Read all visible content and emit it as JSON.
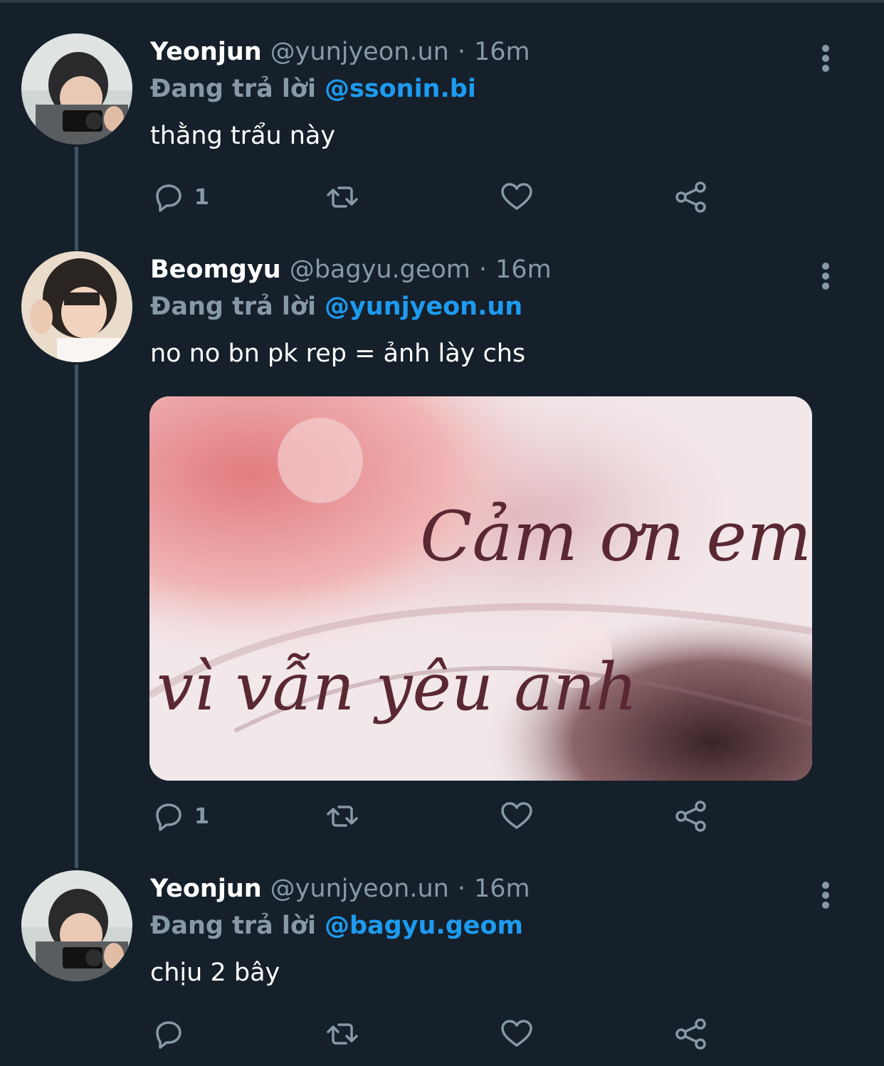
{
  "tweets": [
    {
      "name": "Yeonjun",
      "handle": "@yunjyeon.un",
      "separator": "·",
      "time": "16m",
      "reply_prefix": "Đang trả lời",
      "reply_to": "@ssonin.bi",
      "text": "thằng trẩu này",
      "reply_count": "1"
    },
    {
      "name": "Beomgyu",
      "handle": "@bagyu.geom",
      "separator": "·",
      "time": "16m",
      "reply_prefix": "Đang trả lời",
      "reply_to": "@yunjyeon.un",
      "text": "no no bn pk rep = ảnh lày chs",
      "reply_count": "1",
      "media": {
        "calligraphy_line1": "Cảm ơn em",
        "calligraphy_line2": "vì vẫn yêu anh"
      }
    },
    {
      "name": "Yeonjun",
      "handle": "@yunjyeon.un",
      "separator": "·",
      "time": "16m",
      "reply_prefix": "Đang trả lời",
      "reply_to": "@bagyu.geom",
      "text": "chịu 2 bây",
      "reply_count": ""
    }
  ],
  "colors": {
    "background": "#15202b",
    "secondary_text": "#8899a6",
    "link": "#1d9bf0",
    "thread_line": "#3d5466"
  },
  "icons": [
    "reply-icon",
    "retweet-icon",
    "like-icon",
    "share-icon",
    "more-icon"
  ]
}
